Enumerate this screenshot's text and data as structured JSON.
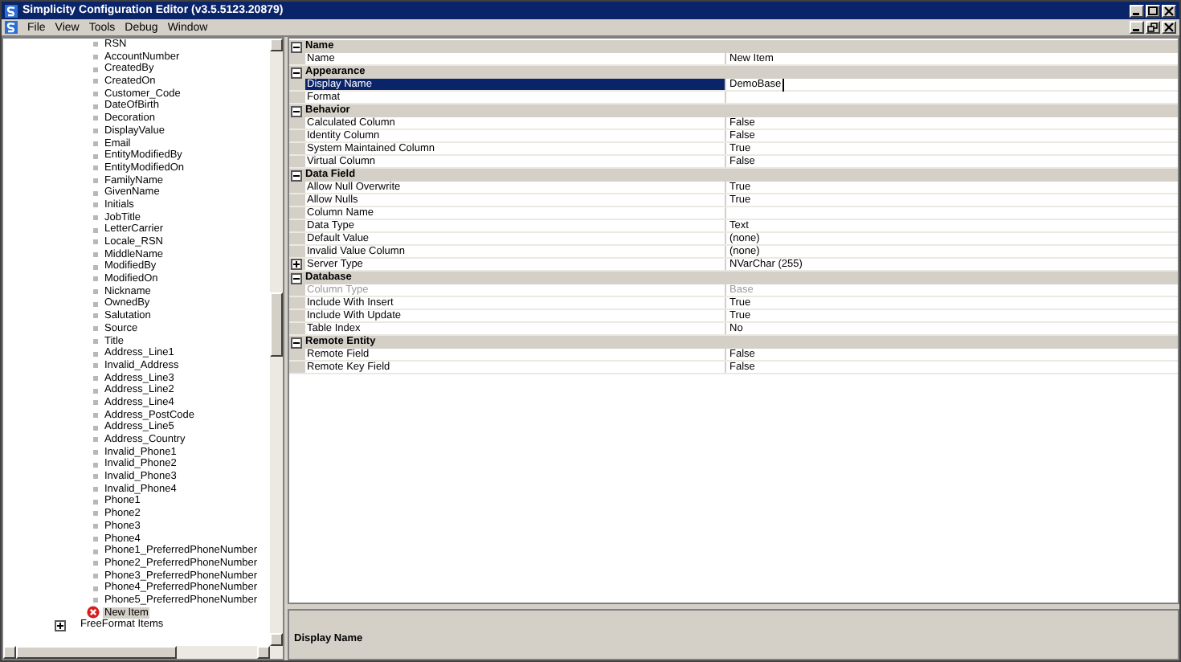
{
  "window": {
    "title": "Simplicity Configuration Editor (v3.5.5123.20879)"
  },
  "menu": [
    "File",
    "View",
    "Tools",
    "Debug",
    "Window"
  ],
  "tree": {
    "items": [
      {
        "label": "RSN",
        "kind": "field",
        "selected": false
      },
      {
        "label": "AccountNumber",
        "kind": "field",
        "selected": false
      },
      {
        "label": "CreatedBy",
        "kind": "field",
        "selected": false
      },
      {
        "label": "CreatedOn",
        "kind": "field",
        "selected": false
      },
      {
        "label": "Customer_Code",
        "kind": "field",
        "selected": false
      },
      {
        "label": "DateOfBirth",
        "kind": "field",
        "selected": false
      },
      {
        "label": "Decoration",
        "kind": "field",
        "selected": false
      },
      {
        "label": "DisplayValue",
        "kind": "field",
        "selected": false
      },
      {
        "label": "Email",
        "kind": "field",
        "selected": false
      },
      {
        "label": "EntityModifiedBy",
        "kind": "field",
        "selected": false
      },
      {
        "label": "EntityModifiedOn",
        "kind": "field",
        "selected": false
      },
      {
        "label": "FamilyName",
        "kind": "field",
        "selected": false
      },
      {
        "label": "GivenName",
        "kind": "field",
        "selected": false
      },
      {
        "label": "Initials",
        "kind": "field",
        "selected": false
      },
      {
        "label": "JobTitle",
        "kind": "field",
        "selected": false
      },
      {
        "label": "LetterCarrier",
        "kind": "field",
        "selected": false
      },
      {
        "label": "Locale_RSN",
        "kind": "field",
        "selected": false
      },
      {
        "label": "MiddleName",
        "kind": "field",
        "selected": false
      },
      {
        "label": "ModifiedBy",
        "kind": "field",
        "selected": false
      },
      {
        "label": "ModifiedOn",
        "kind": "field",
        "selected": false
      },
      {
        "label": "Nickname",
        "kind": "field",
        "selected": false
      },
      {
        "label": "OwnedBy",
        "kind": "field",
        "selected": false
      },
      {
        "label": "Salutation",
        "kind": "field",
        "selected": false
      },
      {
        "label": "Source",
        "kind": "field",
        "selected": false
      },
      {
        "label": "Title",
        "kind": "field",
        "selected": false
      },
      {
        "label": "Address_Line1",
        "kind": "field",
        "selected": false
      },
      {
        "label": "Invalid_Address",
        "kind": "field",
        "selected": false
      },
      {
        "label": "Address_Line3",
        "kind": "field",
        "selected": false
      },
      {
        "label": "Address_Line2",
        "kind": "field",
        "selected": false
      },
      {
        "label": "Address_Line4",
        "kind": "field",
        "selected": false
      },
      {
        "label": "Address_PostCode",
        "kind": "field",
        "selected": false
      },
      {
        "label": "Address_Line5",
        "kind": "field",
        "selected": false
      },
      {
        "label": "Address_Country",
        "kind": "field",
        "selected": false
      },
      {
        "label": "Invalid_Phone1",
        "kind": "field",
        "selected": false
      },
      {
        "label": "Invalid_Phone2",
        "kind": "field",
        "selected": false
      },
      {
        "label": "Invalid_Phone3",
        "kind": "field",
        "selected": false
      },
      {
        "label": "Invalid_Phone4",
        "kind": "field",
        "selected": false
      },
      {
        "label": "Phone1",
        "kind": "field",
        "selected": false
      },
      {
        "label": "Phone2",
        "kind": "field",
        "selected": false
      },
      {
        "label": "Phone3",
        "kind": "field",
        "selected": false
      },
      {
        "label": "Phone4",
        "kind": "field",
        "selected": false
      },
      {
        "label": "Phone1_PreferredPhoneNumber",
        "kind": "field",
        "selected": false
      },
      {
        "label": "Phone2_PreferredPhoneNumber",
        "kind": "field",
        "selected": false
      },
      {
        "label": "Phone3_PreferredPhoneNumber",
        "kind": "field",
        "selected": false
      },
      {
        "label": "Phone4_PreferredPhoneNumber",
        "kind": "field",
        "selected": false
      },
      {
        "label": "Phone5_PreferredPhoneNumber",
        "kind": "field",
        "selected": false
      },
      {
        "label": "New Item",
        "kind": "error",
        "selected": true
      },
      {
        "label": "FreeFormat Items",
        "kind": "group",
        "selected": false
      }
    ]
  },
  "properties": {
    "categories": [
      {
        "name": "Name",
        "expanded": true,
        "rows": [
          {
            "label": "Name",
            "value": "New Item",
            "selected": false,
            "disabled": false,
            "expandable": false
          }
        ]
      },
      {
        "name": "Appearance",
        "expanded": true,
        "rows": [
          {
            "label": "Display Name",
            "value": "DemoBase",
            "selected": true,
            "disabled": false,
            "expandable": false
          },
          {
            "label": "Format",
            "selected": false,
            "disabled": false,
            "expandable": false
          }
        ]
      },
      {
        "name": "Behavior",
        "expanded": true,
        "rows": [
          {
            "label": "Calculated Column",
            "value": "False",
            "selected": false,
            "disabled": false,
            "expandable": false
          },
          {
            "label": "Identity Column",
            "value": "False",
            "selected": false,
            "disabled": false,
            "expandable": false
          },
          {
            "label": "System Maintained Column",
            "value": "True",
            "selected": false,
            "disabled": false,
            "expandable": false
          },
          {
            "label": "Virtual Column",
            "value": "False",
            "selected": false,
            "disabled": false,
            "expandable": false
          }
        ]
      },
      {
        "name": "Data Field",
        "expanded": true,
        "rows": [
          {
            "label": "Allow Null Overwrite",
            "value": "True",
            "selected": false,
            "disabled": false,
            "expandable": false
          },
          {
            "label": "Allow Nulls",
            "value": "True",
            "selected": false,
            "disabled": false,
            "expandable": false
          },
          {
            "label": "Column Name",
            "selected": false,
            "disabled": false,
            "expandable": false
          },
          {
            "label": "Data Type",
            "value": "Text",
            "selected": false,
            "disabled": false,
            "expandable": false
          },
          {
            "label": "Default Value",
            "value": "(none)",
            "selected": false,
            "disabled": false,
            "expandable": false
          },
          {
            "label": "Invalid Value Column",
            "value": "(none)",
            "selected": false,
            "disabled": false,
            "expandable": false
          },
          {
            "label": "Server Type",
            "value": "NVarChar (255)",
            "selected": false,
            "disabled": false,
            "expandable": true
          }
        ]
      },
      {
        "name": "Database",
        "expanded": true,
        "rows": [
          {
            "label": "Column Type",
            "value": "Base",
            "selected": false,
            "disabled": true,
            "expandable": false
          },
          {
            "label": "Include With Insert",
            "value": "True",
            "selected": false,
            "disabled": false,
            "expandable": false
          },
          {
            "label": "Include With Update",
            "value": "True",
            "selected": false,
            "disabled": false,
            "expandable": false
          },
          {
            "label": "Table Index",
            "value": "No",
            "selected": false,
            "disabled": false,
            "expandable": false
          }
        ]
      },
      {
        "name": "Remote Entity",
        "expanded": true,
        "rows": [
          {
            "label": "Remote Field",
            "value": "False",
            "selected": false,
            "disabled": false,
            "expandable": false
          },
          {
            "label": "Remote Key Field",
            "value": "False",
            "selected": false,
            "disabled": false,
            "expandable": false
          }
        ]
      }
    ]
  },
  "description": {
    "title": "Display Name"
  }
}
